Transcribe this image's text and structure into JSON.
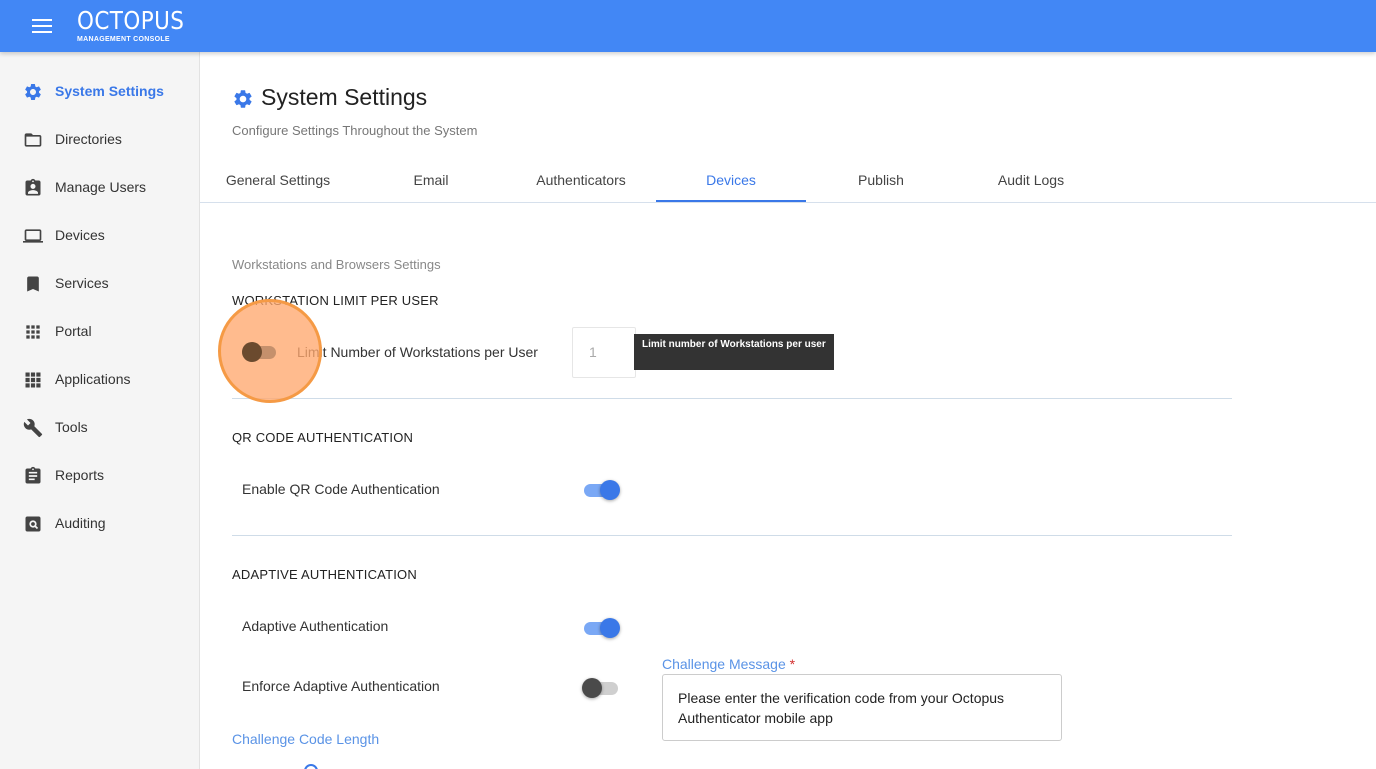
{
  "header": {
    "brand_title": "OCTOPUS",
    "brand_subtitle": "MANAGEMENT CONSOLE"
  },
  "sidebar": {
    "items": [
      {
        "label": "System Settings",
        "icon": "gear-icon",
        "active": true
      },
      {
        "label": "Directories",
        "icon": "folder-icon"
      },
      {
        "label": "Manage Users",
        "icon": "user-badge-icon"
      },
      {
        "label": "Devices",
        "icon": "laptop-icon"
      },
      {
        "label": "Services",
        "icon": "bookmark-icon"
      },
      {
        "label": "Portal",
        "icon": "grid-dots-icon"
      },
      {
        "label": "Applications",
        "icon": "grid-squares-icon"
      },
      {
        "label": "Tools",
        "icon": "wrench-icon"
      },
      {
        "label": "Reports",
        "icon": "clipboard-icon"
      },
      {
        "label": "Auditing",
        "icon": "search-box-icon"
      }
    ]
  },
  "page": {
    "title": "System Settings",
    "subtitle": "Configure Settings Throughout the System"
  },
  "tabs": [
    {
      "label": "General Settings"
    },
    {
      "label": "Email"
    },
    {
      "label": "Authenticators"
    },
    {
      "label": "Devices",
      "active": true
    },
    {
      "label": "Publish"
    },
    {
      "label": "Audit Logs"
    }
  ],
  "content": {
    "section_caption": "Workstations and Browsers Settings",
    "workstation": {
      "title": "WORKSTATION LIMIT PER USER",
      "toggle_label": "Limit Number of Workstations per User",
      "toggle_on": false,
      "limit_value": "1",
      "tooltip": "Limit number of Workstations per user"
    },
    "qr": {
      "title": "QR CODE AUTHENTICATION",
      "toggle_label": "Enable QR Code Authentication",
      "toggle_on": true
    },
    "adaptive": {
      "title": "ADAPTIVE AUTHENTICATION",
      "adaptive_label": "Adaptive Authentication",
      "adaptive_on": true,
      "enforce_label": "Enforce Adaptive Authentication",
      "enforce_on": false,
      "challenge_message_label": "Challenge Message",
      "required_mark": "*",
      "challenge_message_value": "Please enter the verification code from your Octopus Authenticator mobile app",
      "challenge_code_length_label": "Challenge Code Length"
    }
  },
  "colors": {
    "accent": "#3a78e8",
    "topbar": "#4287f5",
    "click_indicator": "#f59a45"
  }
}
